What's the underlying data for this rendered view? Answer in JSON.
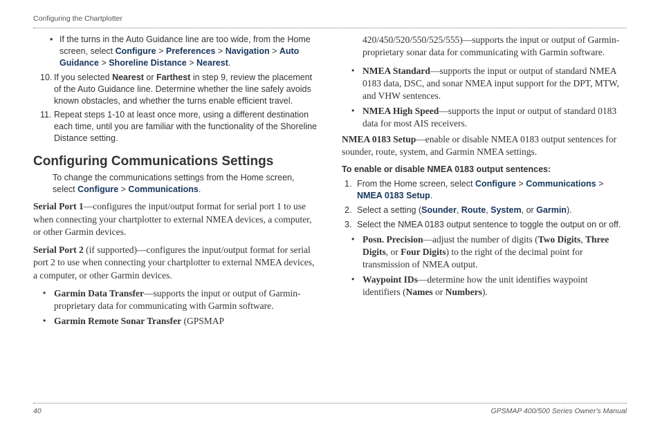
{
  "header": "Configuring the Chartplotter",
  "footer": {
    "page": "40",
    "manual": "GPSMAP 400/500 Series Owner's Manual"
  },
  "left": {
    "bullet1_a": "If the turns in the Auto Guidance line are too wide, from the Home screen, select ",
    "bullet1_path": [
      "Configure",
      "Preferences",
      "Navigation",
      "Auto Guidance",
      "Shoreline Distance",
      "Nearest"
    ],
    "step10_n": "10.",
    "step10_a": "If you selected ",
    "step10_b": "Nearest",
    "step10_c": " or ",
    "step10_d": "Farthest",
    "step10_e": " in step 9, review the placement of the Auto Guidance line. Determine whether the line safely avoids known obstacles, and whether the turns enable efficient travel.",
    "step11_n": "11.",
    "step11": "Repeat steps 1-10 at least once more, using a different destination each time, until you are familiar with the functionality of the Shoreline Distance setting.",
    "h2": "Configuring Communications Settings",
    "intro_a": "To change the communications settings from the Home screen, select ",
    "intro_path": [
      "Configure",
      "Communications"
    ],
    "sp1_label": "Serial Port 1",
    "sp1_txt": "—configures the input/output format for serial port 1 to use when connecting your chartplotter to external NMEA devices, a computer, or other Garmin devices.",
    "sp2_label": "Serial Port 2",
    "sp2_paren": " (if supported)",
    "sp2_txt": "—configures the input/output format for serial port 2 to use when connecting your chartplotter to external NMEA devices, a computer, or other Garmin devices.",
    "gdt_label": "Garmin Data Transfer",
    "gdt_txt": "—supports the input or output of Garmin-proprietary data for communicating with Garmin software.",
    "grst_label": "Garmin Remote Sonar Transfer",
    "grst_paren": " (GPSMAP"
  },
  "right": {
    "cont": "420/450/520/550/525/555)—supports the input or output of Garmin-proprietary sonar data for communicating with Garmin software.",
    "nmea_std_label": "NMEA Standard",
    "nmea_std_txt": "—supports the input or output of standard NMEA 0183 data, DSC, and sonar NMEA input support for the DPT, MTW, and VHW sentences.",
    "nmea_hs_label": "NMEA High Speed",
    "nmea_hs_txt": "—supports the input or output of standard 0183 data for most AIS receivers.",
    "nmea_setup_label": "NMEA 0183 Setup",
    "nmea_setup_txt": "—enable or disable NMEA 0183 output sentences for sounder, route, system, and Garmin NMEA settings.",
    "enable_head": "To enable or disable NMEA 0183 output sentences:",
    "s1_n": "1.",
    "s1_a": "From the Home screen, select ",
    "s1_path": [
      "Configure",
      "Communications",
      "NMEA 0183 Setup"
    ],
    "s2_n": "2.",
    "s2_a": "Select a setting (",
    "s2_opts": [
      "Sounder",
      "Route",
      "System",
      "Garmin"
    ],
    "s2_b": ").",
    "s3_n": "3.",
    "s3": "Select the NMEA 0183 output sentence to toggle the output on or off.",
    "posn_label": "Posn. Precision",
    "posn_a": "—adjust the number of digits (",
    "posn_b1": "Two Digits",
    "posn_b2": "Three Digits",
    "posn_b3": "Four Digits",
    "posn_c": ") to the right of the decimal point for transmission of NMEA output.",
    "wp_label": "Waypoint IDs",
    "wp_a": "—determine how the unit identifies waypoint identifiers (",
    "wp_b1": "Names",
    "wp_b2": "Numbers",
    "wp_c": ")."
  }
}
